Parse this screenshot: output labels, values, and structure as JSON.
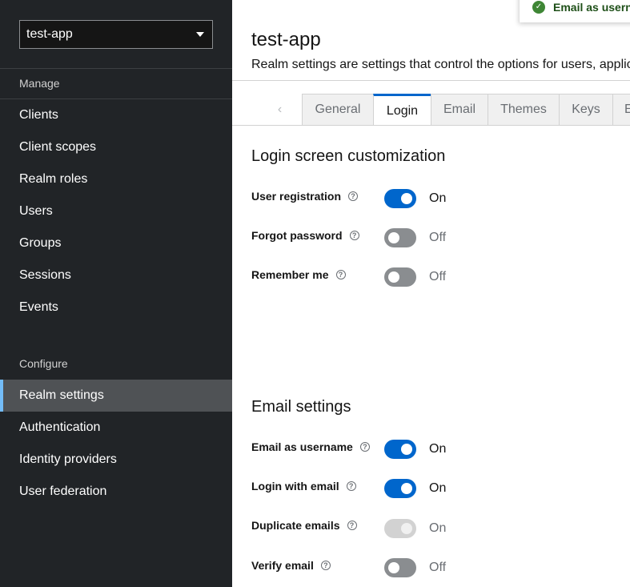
{
  "sidebar": {
    "realm_selector": {
      "value": "test-app"
    },
    "manage_title": "Manage",
    "configure_title": "Configure",
    "manage_items": [
      {
        "label": "Clients"
      },
      {
        "label": "Client scopes"
      },
      {
        "label": "Realm roles"
      },
      {
        "label": "Users"
      },
      {
        "label": "Groups"
      },
      {
        "label": "Sessions"
      },
      {
        "label": "Events"
      }
    ],
    "configure_items": [
      {
        "label": "Realm settings",
        "active": true
      },
      {
        "label": "Authentication"
      },
      {
        "label": "Identity providers"
      },
      {
        "label": "User federation"
      }
    ]
  },
  "header": {
    "title": "test-app",
    "description": "Realm settings are settings that control the options for users, applic"
  },
  "tabs": {
    "scroll_left": "‹",
    "items": [
      {
        "label": "General"
      },
      {
        "label": "Login",
        "active": true
      },
      {
        "label": "Email"
      },
      {
        "label": "Themes"
      },
      {
        "label": "Keys"
      },
      {
        "label": "E"
      }
    ]
  },
  "login_section": {
    "heading": "Login screen customization",
    "rows": [
      {
        "label": "User registration",
        "state": "On"
      },
      {
        "label": "Forgot password",
        "state": "Off"
      },
      {
        "label": "Remember me",
        "state": "Off"
      }
    ]
  },
  "email_section": {
    "heading": "Email settings",
    "rows": [
      {
        "label": "Email as username",
        "state": "On"
      },
      {
        "label": "Login with email",
        "state": "On"
      },
      {
        "label": "Duplicate emails",
        "state": "On",
        "disabled": true
      },
      {
        "label": "Verify email",
        "state": "Off"
      }
    ]
  },
  "toast": {
    "message": "Email as userna"
  },
  "colors": {
    "accent": "#0066cc",
    "sidebar_bg": "#212427",
    "active_nav": "#4f5255",
    "success": "#3e8635"
  },
  "icons": {
    "help": "help-icon",
    "caret": "caret-down-icon",
    "check": "check-circle-icon"
  }
}
